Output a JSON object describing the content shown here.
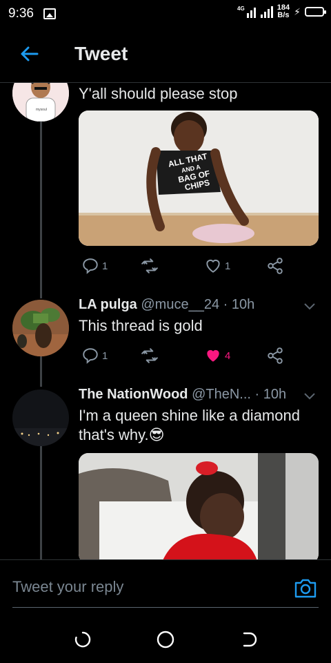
{
  "status_bar": {
    "time": "9:36",
    "net_speed_value": "184",
    "net_speed_unit": "B/s",
    "network_type": "4G",
    "charging_symbol": "⚡"
  },
  "header": {
    "title": "Tweet"
  },
  "tweets": [
    {
      "text": "Y'all should please stop",
      "actions": {
        "replies": "1",
        "retweets": "",
        "likes": "1"
      },
      "avatar_label": "mysoul"
    },
    {
      "name": "LA pulga",
      "handle": "@muce__24",
      "sep": "·",
      "time": "10h",
      "text": "This thread is gold",
      "actions": {
        "replies": "1",
        "retweets": "",
        "likes": "4"
      }
    },
    {
      "name": "The NationWood",
      "handle": "@TheN...",
      "sep": "·",
      "time": "10h",
      "text_line1": "I'm a queen shine like a diamond",
      "text_line2": "that's why.",
      "emoji": "😎"
    }
  ],
  "media1_shirt_text": [
    "ALL THAT",
    "AND A",
    "BAG OF",
    "CHIPS"
  ],
  "reply": {
    "placeholder": "Tweet your reply"
  },
  "colors": {
    "accent": "#1d9bf0",
    "like": "#f91880",
    "muted": "#8b98a5"
  }
}
